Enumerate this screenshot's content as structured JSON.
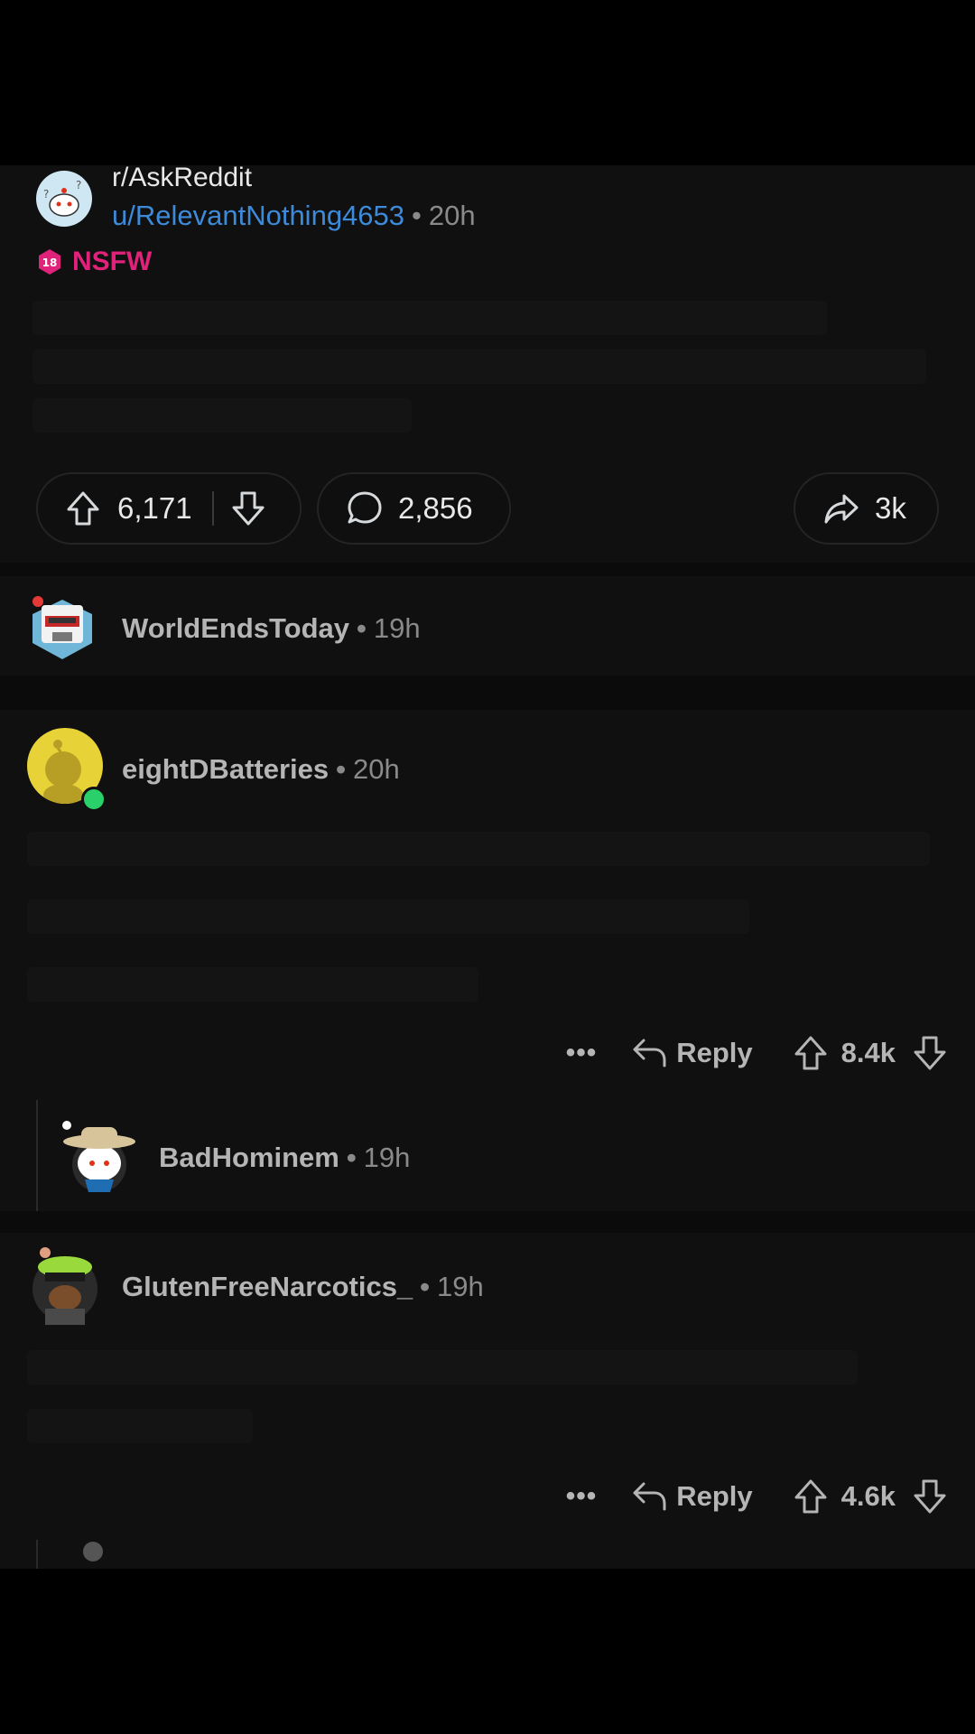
{
  "post": {
    "subreddit": "r/AskReddit",
    "author": "u/RelevantNothing4653",
    "separator": "•",
    "time": "20h",
    "nsfw_label": "NSFW",
    "nsfw_badge_text": "18",
    "upvotes": "6,171",
    "comments": "2,856",
    "shares": "3k"
  },
  "comments": [
    {
      "username": "WorldEndsToday",
      "time": "19h"
    },
    {
      "username": "eightDBatteries",
      "time": "20h",
      "online": true,
      "reply_label": "Reply",
      "votes": "8.4k",
      "more": "•••"
    },
    {
      "username": "BadHominem",
      "time": "19h"
    },
    {
      "username": "GlutenFreeNarcotics_",
      "time": "19h",
      "reply_label": "Reply",
      "votes": "4.6k",
      "more": "•••"
    }
  ],
  "colors": {
    "accent_link": "#3d8ad9",
    "nsfw": "#e0227a",
    "online": "#2ad16b"
  },
  "icons": [
    "subreddit-avatar",
    "nsfw-badge-icon",
    "upvote-icon",
    "downvote-icon",
    "comment-icon",
    "share-icon",
    "more-icon",
    "reply-icon"
  ]
}
